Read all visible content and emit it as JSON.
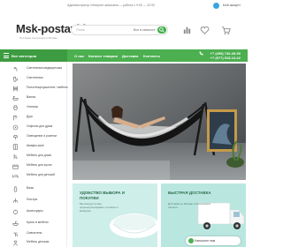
{
  "topbar": {
    "hours": "Администратор Интернет-магазина — работа с 9:00 — 22:00",
    "account": "Мой аккаунт"
  },
  "header": {
    "logo": "Msk-postavki",
    "logo_sub": "Поставка сантехники в Москве",
    "search_placeholder": "Поиск",
    "search_scope": "Все в каталоге"
  },
  "nav": {
    "catalog_label": "Все категории",
    "links": [
      "О нас",
      "Каталог товаров",
      "Доставка",
      "Контакты"
    ]
  },
  "contacts": {
    "phones": [
      "+7 (495) 740-28-90",
      "+7 (977) 515-14-22"
    ]
  },
  "sidebar": {
    "items": [
      {
        "label": "Сантехника медицинская",
        "icon": "faucet-icon"
      },
      {
        "label": "Сантехника",
        "icon": "toilet-icon"
      },
      {
        "label": "Полотенцесушители / мебель",
        "icon": "towel-rail-icon"
      },
      {
        "label": "Ванны",
        "icon": "bathtub-icon"
      },
      {
        "label": "Унитазы",
        "icon": "toilet-icon"
      },
      {
        "label": "Душ",
        "icon": "shower-icon"
      },
      {
        "label": "Сифоны для душа",
        "icon": "drain-icon"
      },
      {
        "label": "Освещение и розетки",
        "icon": "lamp-icon"
      },
      {
        "label": "Шкафы-купе",
        "icon": "cabinet-icon"
      },
      {
        "label": "Мебель для дома",
        "icon": "chair-icon"
      },
      {
        "label": "Мебель для кухни",
        "icon": "kitchen-icon"
      },
      {
        "label": "Мебель для детской",
        "icon": "bed-icon"
      },
      {
        "label": "Вазы",
        "icon": "vase-icon"
      },
      {
        "label": "Люстры",
        "icon": "chandelier-icon"
      },
      {
        "label": "Аксессуары",
        "icon": "accessory-icon"
      },
      {
        "label": "Кухни в мебели",
        "icon": "sink-icon"
      },
      {
        "label": "Смесители",
        "icon": "mixer-icon"
      },
      {
        "label": "Мебель детская",
        "icon": "child-icon"
      }
    ]
  },
  "promos": [
    {
      "title": "УДОБСТВО ВЫБОРА И ПОКУПКИ",
      "desc": "Мы всегда готовы проконсультировать и помочь с выбором"
    },
    {
      "title": "БЫСТРАЯ ДОСТАВКА",
      "desc": "Доставка по Москве и Московской области"
    }
  ],
  "chat": {
    "label": "Напишите нам"
  },
  "colors": {
    "brand_green": "#4caf50",
    "dark_green": "#3d9c41",
    "promo_mint": "#cdeee9"
  }
}
